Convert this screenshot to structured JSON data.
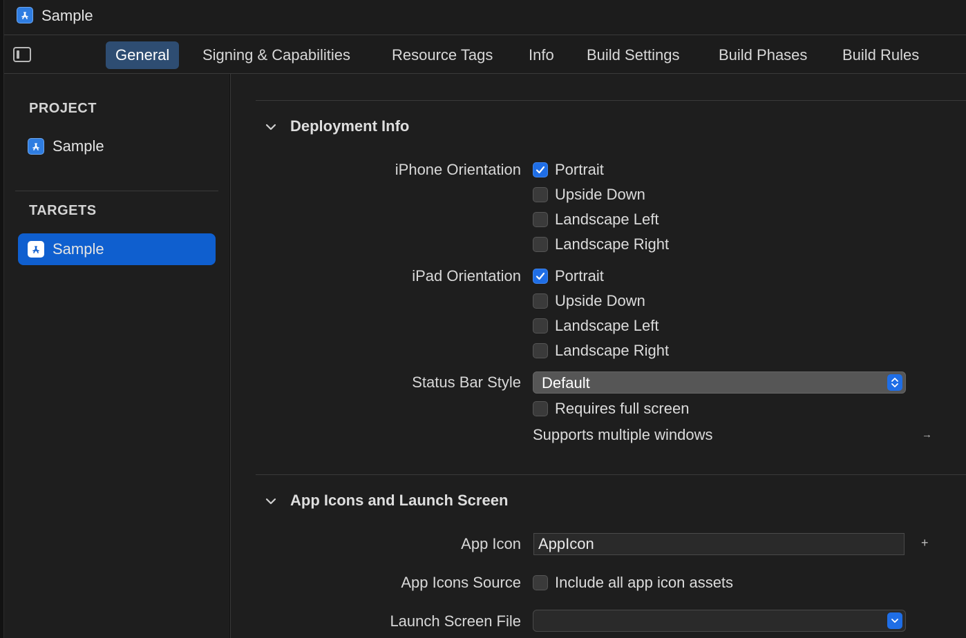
{
  "window": {
    "title": "Sample"
  },
  "tabs": [
    {
      "label": "General",
      "active": true
    },
    {
      "label": "Signing & Capabilities"
    },
    {
      "label": "Resource Tags"
    },
    {
      "label": "Info"
    },
    {
      "label": "Build Settings"
    },
    {
      "label": "Build Phases"
    },
    {
      "label": "Build Rules"
    }
  ],
  "sidebar": {
    "project_header": "PROJECT",
    "project_item": "Sample",
    "targets_header": "TARGETS",
    "target_item": "Sample"
  },
  "deployment": {
    "title": "Deployment Info",
    "iphone_label": "iPhone Orientation",
    "iphone": [
      {
        "label": "Portrait",
        "checked": true
      },
      {
        "label": "Upside Down",
        "checked": false
      },
      {
        "label": "Landscape Left",
        "checked": false
      },
      {
        "label": "Landscape Right",
        "checked": false
      }
    ],
    "ipad_label": "iPad Orientation",
    "ipad": [
      {
        "label": "Portrait",
        "checked": true
      },
      {
        "label": "Upside Down",
        "checked": false
      },
      {
        "label": "Landscape Left",
        "checked": false
      },
      {
        "label": "Landscape Right",
        "checked": false
      }
    ],
    "status_bar_label": "Status Bar Style",
    "status_bar_value": "Default",
    "requires_full_screen": "Requires full screen",
    "supports_multiple_windows": "Supports multiple windows"
  },
  "app_icons": {
    "title": "App Icons and Launch Screen",
    "app_icon_label": "App Icon",
    "app_icon_value": "AppIcon",
    "source_label": "App Icons Source",
    "include_all": "Include all app icon assets",
    "launch_label": "Launch Screen File",
    "launch_value": ""
  },
  "colors": {
    "accent": "#1f6ee6",
    "selected_row": "#0f5fcf",
    "active_tab": "#2e4d72"
  }
}
